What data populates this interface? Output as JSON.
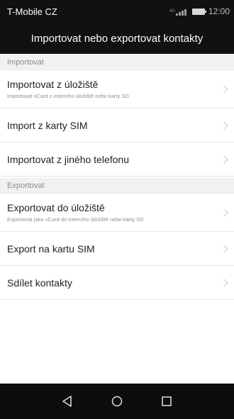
{
  "status_bar": {
    "carrier": "T-Mobile CZ",
    "network_label": "4G",
    "time": "12:00"
  },
  "header": {
    "title": "Importovat nebo exportovat kontakty"
  },
  "sections": {
    "import": {
      "label": "Importovat",
      "items": [
        {
          "title": "Importovat z úložiště",
          "subtitle": "Importovat vCard z interního úložiště nebo karty SD"
        },
        {
          "title": "Import z karty SIM",
          "subtitle": ""
        },
        {
          "title": "Importovat z jiného telefonu",
          "subtitle": ""
        }
      ]
    },
    "export": {
      "label": "Exportovat",
      "items": [
        {
          "title": "Exportovat do úložiště",
          "subtitle": "Exportovat jako vCard do interního úložiště nebo karty SD"
        },
        {
          "title": "Export na kartu SIM",
          "subtitle": ""
        },
        {
          "title": "Sdílet kontakty",
          "subtitle": ""
        }
      ]
    }
  },
  "nav_bar": {
    "icons": [
      "back-icon",
      "home-icon",
      "recents-icon"
    ]
  }
}
